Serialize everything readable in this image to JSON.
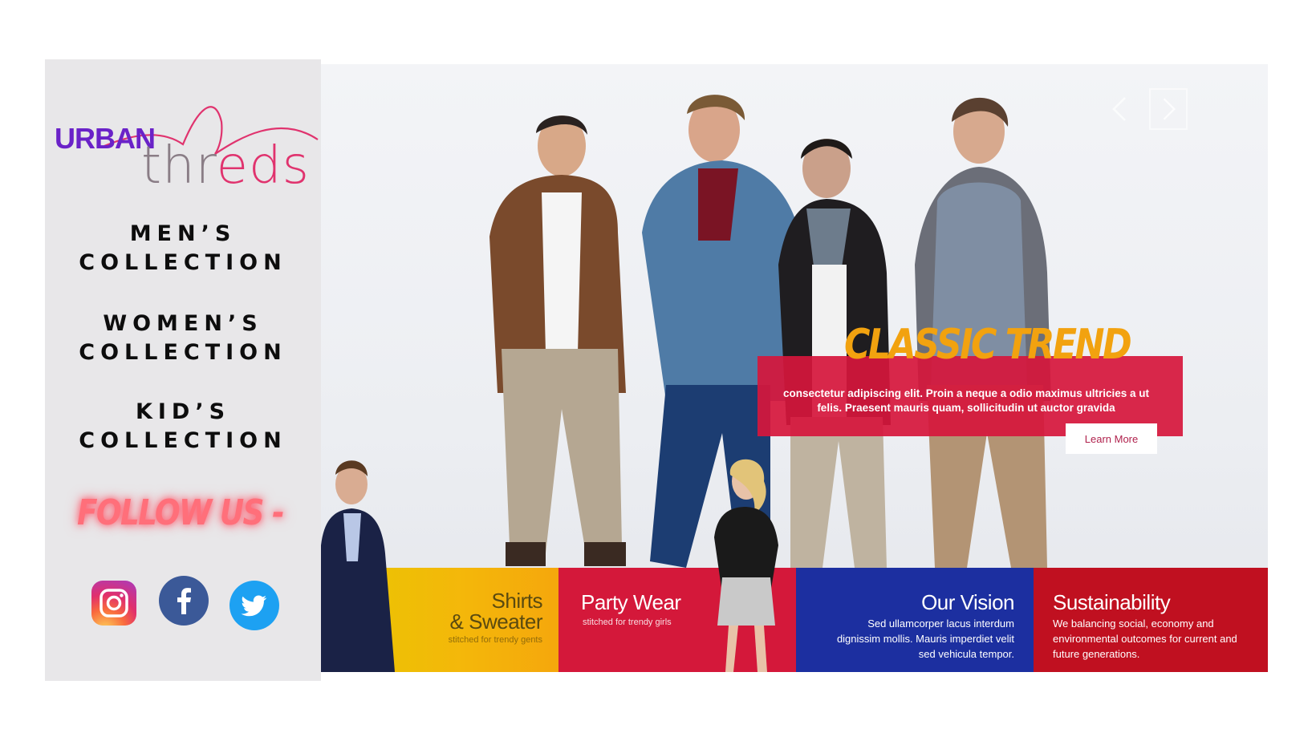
{
  "brand": {
    "logo_word1": "URBAN",
    "logo_word2_a": "thr",
    "logo_word2_b": "eds",
    "logo_color_primary": "#6a22c8",
    "logo_color_accent": "#e0336e"
  },
  "sidebar": {
    "nav": [
      {
        "label": "MEN’S\nCOLLECTION"
      },
      {
        "label": "WOMEN’S\nCOLLECTION"
      },
      {
        "label": "KID’S\nCOLLECTION"
      }
    ],
    "follow_label": "FOLLOW US -",
    "social": [
      {
        "icon": "instagram-icon",
        "color": "#e1306c"
      },
      {
        "icon": "facebook-icon",
        "color": "#3b5998"
      },
      {
        "icon": "twitter-icon",
        "color": "#1da1f2"
      }
    ]
  },
  "hero": {
    "title": "CLASSIC TREND",
    "text": "consectetur adipiscing elit. Proin a neque a odio maximus ultricies a ut felis. Praesent mauris quam, sollicitudin ut auctor gravida",
    "button_label": "Learn More",
    "accent_color": "#d6163c",
    "title_color": "#f2a20f"
  },
  "tiles": [
    {
      "title": "Shirts\n& Sweater",
      "subtitle": "stitched for trendy gents"
    },
    {
      "title": "Party Wear",
      "subtitle": "stitched for trendy girls"
    },
    {
      "title": "Our Vision",
      "description": "Sed ullamcorper lacus interdum dignissim mollis. Mauris imperdiet velit sed vehicula tempor."
    },
    {
      "title": "Sustainability",
      "description": "We balancing social, economy and environmental outcomes for current and future generations."
    }
  ]
}
